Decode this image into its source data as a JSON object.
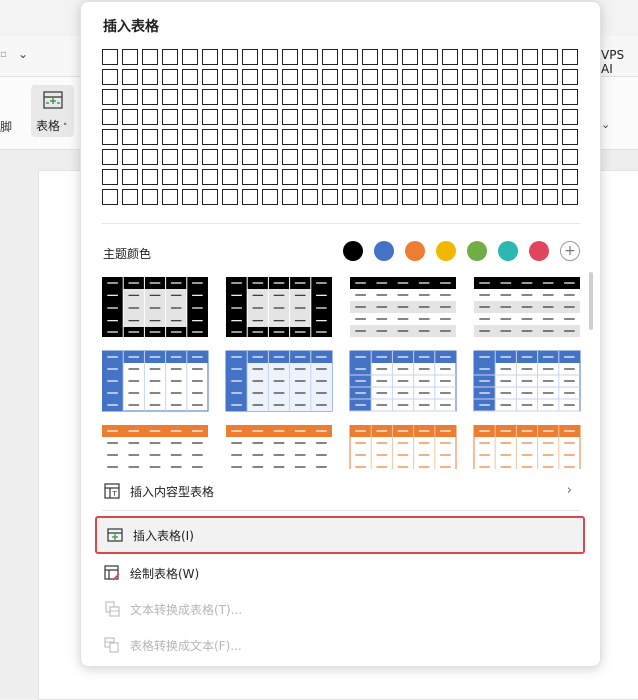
{
  "background": {
    "left_text": "脚",
    "table_button_label": "表格",
    "wps_label": "VPS AI",
    "chevron_left": "⌄",
    "chevron_right": "⌄"
  },
  "panel": {
    "title": "插入表格",
    "grid": {
      "columns": 24,
      "rows": 8
    },
    "theme_colors_label": "主题颜色",
    "theme_colors": [
      "#000000",
      "#4472c4",
      "#ed7d31",
      "#f2b800",
      "#70ad47",
      "#2cb7b2",
      "#e0455b"
    ],
    "menu": {
      "insert_content_table": "插入内容型表格",
      "insert_table": "插入表格(I)",
      "draw_table": "绘制表格(W)",
      "text_to_table": "文本转换成表格(T)...",
      "table_to_text": "表格转换成文本(F)..."
    }
  }
}
